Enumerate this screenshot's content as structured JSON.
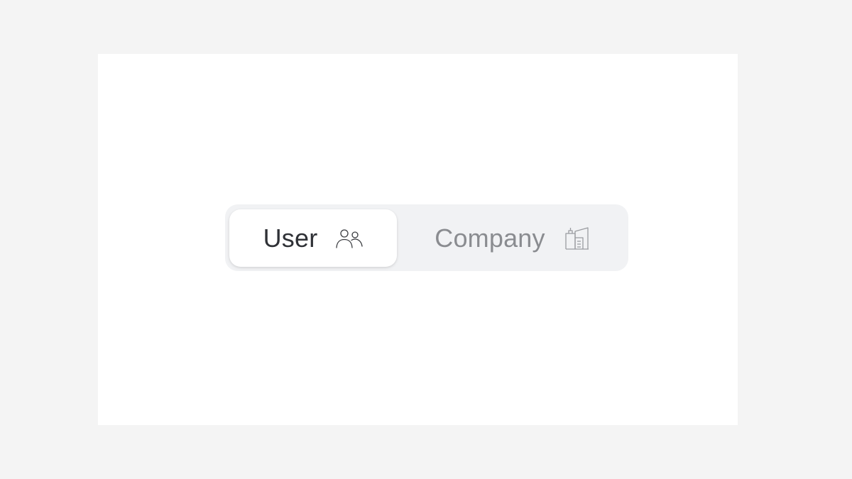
{
  "switcher": {
    "options": [
      {
        "label": "User",
        "icon": "users-icon",
        "selected": true
      },
      {
        "label": "Company",
        "icon": "building-icon",
        "selected": false
      }
    ]
  },
  "colors": {
    "page_background": "#f4f4f4",
    "canvas_background": "#ffffff",
    "track_background": "#f1f2f4",
    "selected_background": "#ffffff",
    "selected_text": "#2f3136",
    "unselected_text": "#8a8c90"
  }
}
